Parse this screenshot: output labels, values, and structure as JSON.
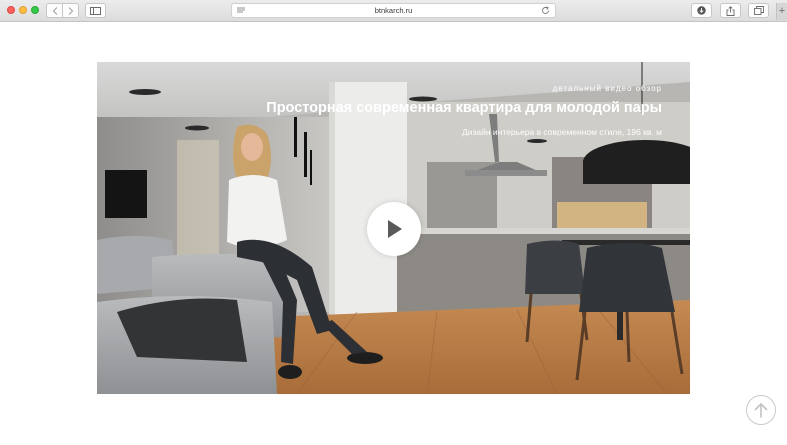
{
  "browser": {
    "url": "btnkarch.ru",
    "new_tab_glyph": "+",
    "icons": [
      "sidebar-icon",
      "back-icon",
      "forward-icon",
      "reader-menu-icon",
      "reload-icon",
      "download-icon",
      "share-icon",
      "tabs-icon"
    ]
  },
  "video": {
    "kicker": "детальный видео обзор",
    "title": "Просторная современная квартира для молодой пары",
    "subtitle": "Дизайн интерьера в современном стиле, 196 кв. м",
    "play_icon": "play-icon"
  },
  "scroll_top": {
    "icon": "arrow-up-icon"
  },
  "colors": {
    "toolbar": "#dcdcdc",
    "overlay_text": "#ffffff",
    "play_button": "#ffffff",
    "play_triangle": "#5a5a5a",
    "scroll_button_border": "#c9c9c9"
  }
}
